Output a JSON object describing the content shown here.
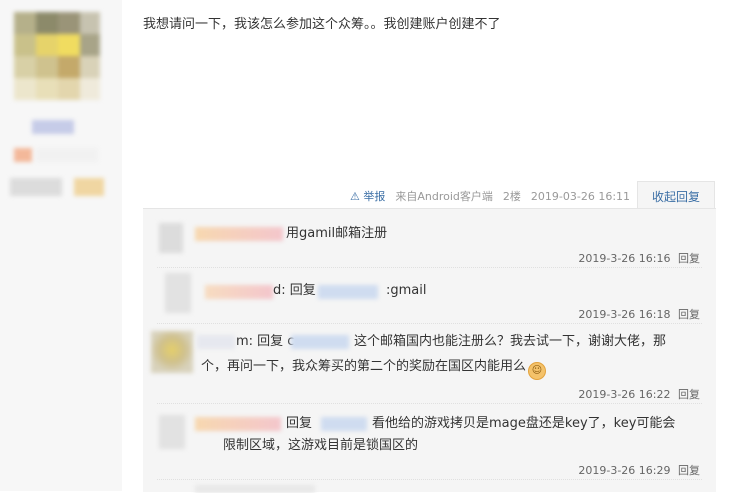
{
  "post": {
    "text": "我想请问一下，我该怎么参加这个众筹。。我创建账户创建不了",
    "meta": {
      "report_label": "举报",
      "source": "来自Android客户端",
      "floor": "2楼",
      "timestamp": "2019-03-26 16:11"
    },
    "collapse_label": "收起回复"
  },
  "replies": [
    {
      "segments": [
        "用gamil邮箱注册"
      ],
      "time": "2019-3-26 16:16",
      "reply_label": "回复"
    },
    {
      "prefix": "d: 回复",
      "segments": [
        ":gmail"
      ],
      "time": "2019-3-26 16:18",
      "reply_label": "回复"
    },
    {
      "prefix": "m: 回复 c",
      "segments": [
        "这个邮箱国内也能注册么？我去试一下，谢谢大佬，那",
        "个，再问一下，我众筹买的第二个的奖励在国区内能用么"
      ],
      "time": "2019-3-26 16:22",
      "reply_label": "回复"
    },
    {
      "prefix": "回复",
      "segments": [
        "看他给的游戏拷贝是mage盘还是key了，key可能会",
        "限制区域，这游戏目前是锁国区的"
      ],
      "time": "2019-3-26 16:29",
      "reply_label": "回复"
    }
  ],
  "icons": {
    "report": "warning-icon",
    "emoji": "smile-emoji-icon"
  },
  "colors": {
    "link": "#3a6ea5",
    "reply_bg": "#f5f5f5",
    "meta": "#999999",
    "sidebar_bg": "#f7f7f7"
  }
}
